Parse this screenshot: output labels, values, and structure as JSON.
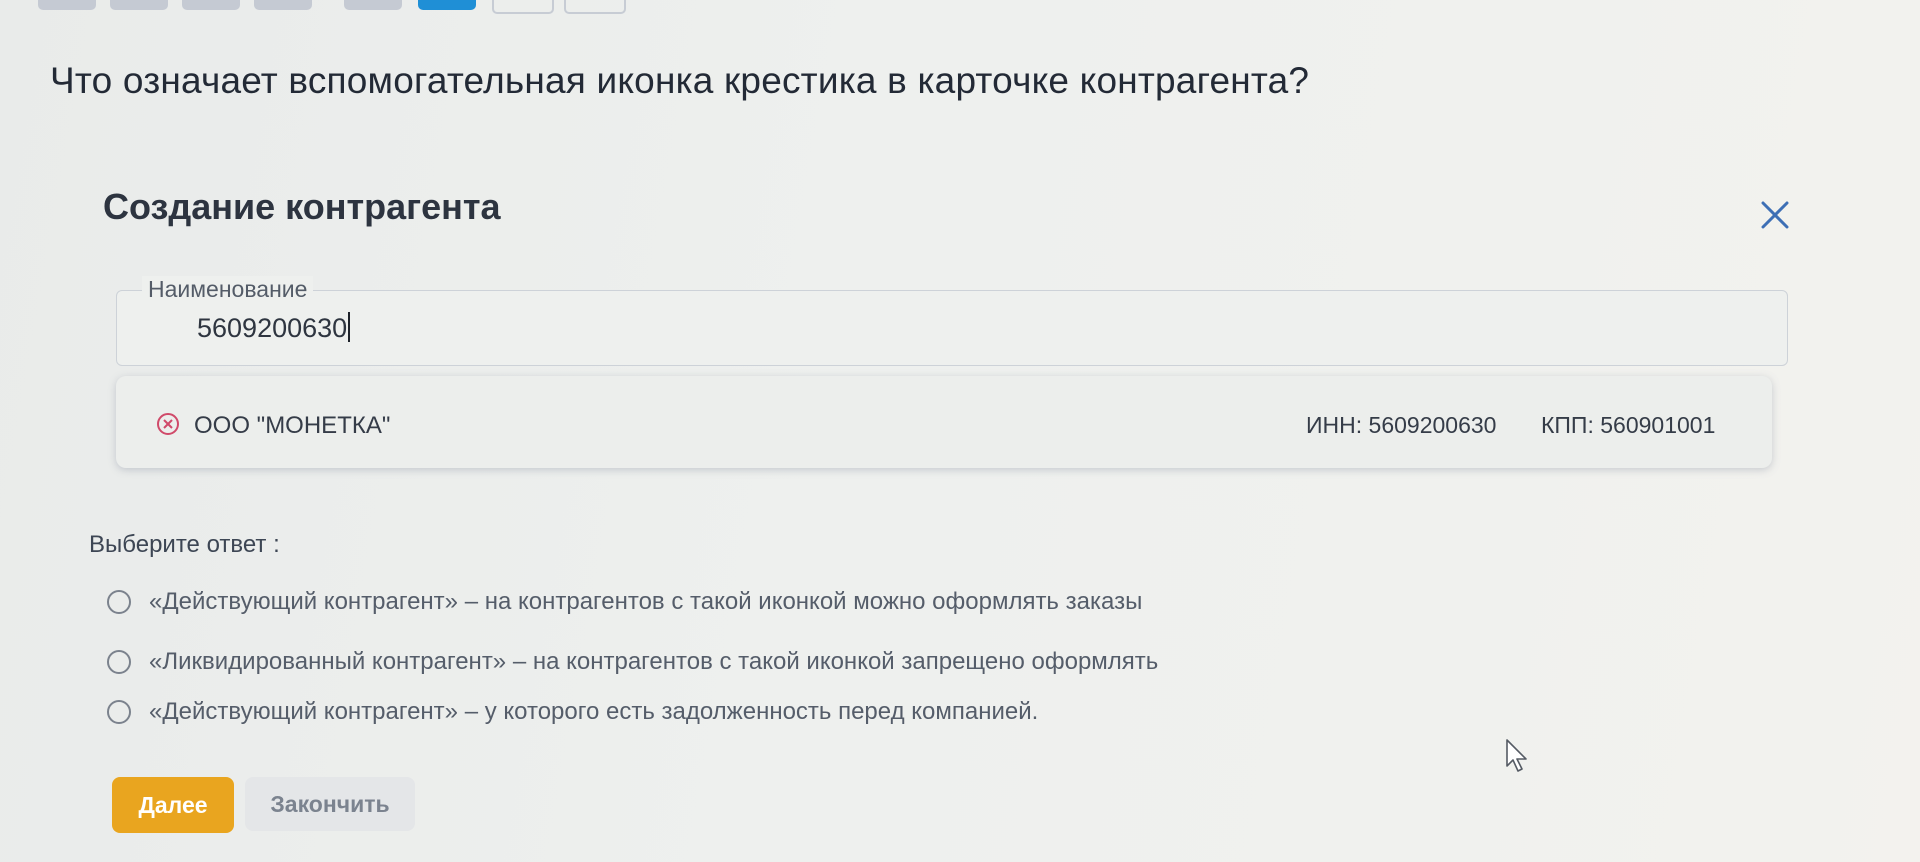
{
  "question": "Что означает вспомогательная иконка крестика в карточке контрагента?",
  "dialog": {
    "title": "Создание контрагента",
    "name_label": "Наименование",
    "name_value": "5609200630"
  },
  "result": {
    "company": "ООО \"МОНЕТКА\"",
    "inn": "ИНН: 5609200630",
    "kpp": "КПП: 560901001",
    "icon": "x-circle-icon"
  },
  "answers": {
    "label": "Выберите ответ :",
    "options": [
      "«Действующий контрагент» – на контрагентов с такой иконкой можно оформлять заказы",
      "«Ликвидированный контрагент» – на контрагентов с такой иконкой запрещено оформлять",
      "«Действующий контрагент» – у которого есть задолженность перед компанией."
    ]
  },
  "buttons": {
    "next": "Далее",
    "finish": "Закончить"
  },
  "colors": {
    "accent": "#e9a51f",
    "active_step": "#1f8fd6",
    "x_icon": "#d04a6a"
  }
}
